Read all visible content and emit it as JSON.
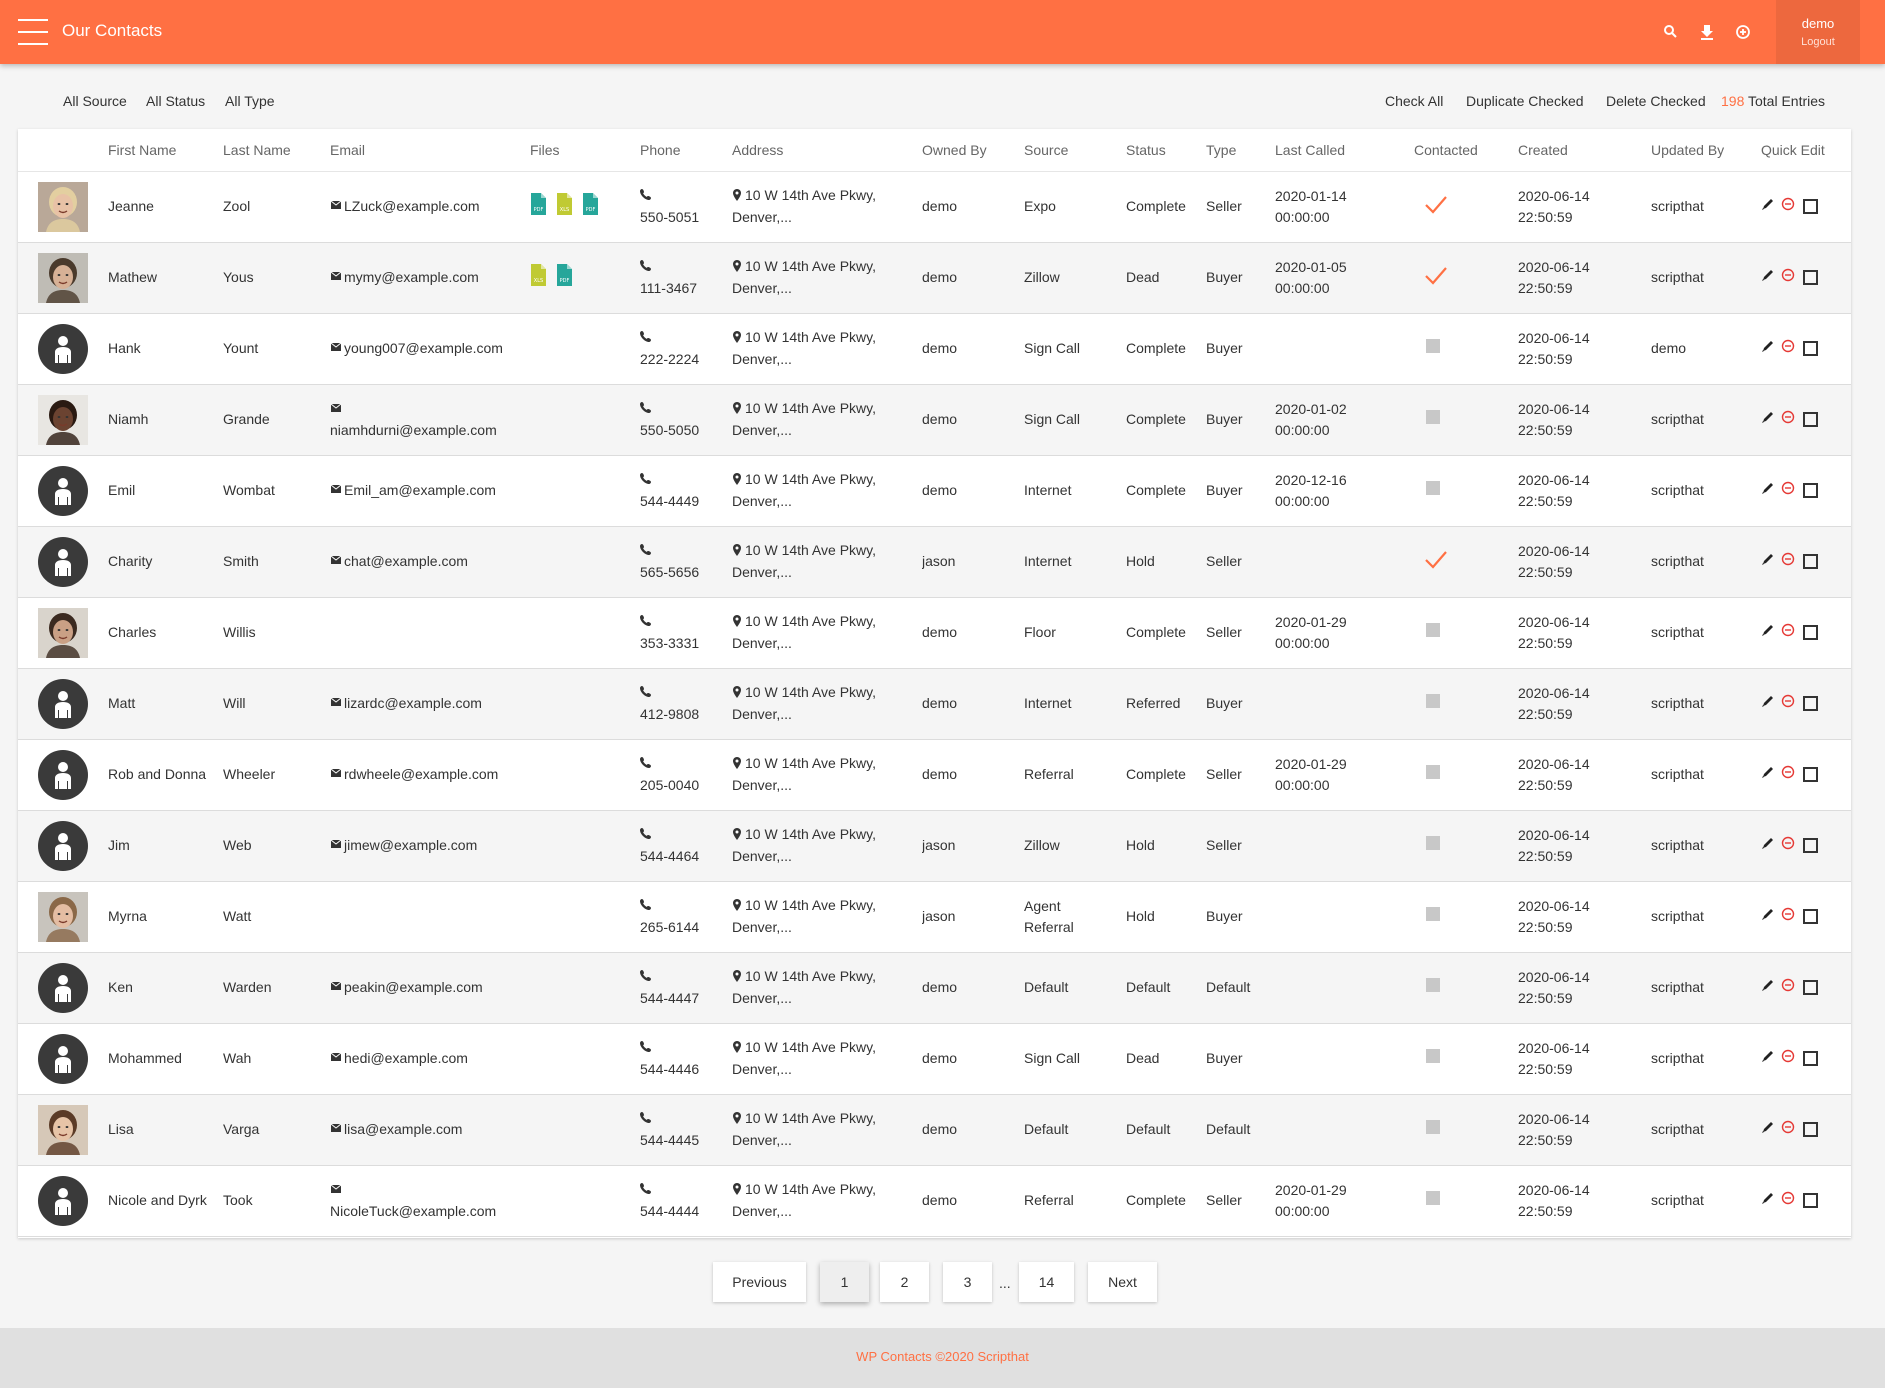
{
  "header": {
    "title": "Our Contacts",
    "user": "demo",
    "logout": "Logout",
    "accent_color": "#ff7043",
    "icons": [
      "search-icon",
      "download-icon",
      "add-icon"
    ]
  },
  "filters": {
    "source": "All Source",
    "status": "All Status",
    "type": "All Type"
  },
  "actions": {
    "check_all": "Check All",
    "duplicate_checked": "Duplicate Checked",
    "delete_checked": "Delete Checked",
    "total_count": "198",
    "total_label": "Total Entries"
  },
  "columns": [
    "First Name",
    "Last Name",
    "Email",
    "Files",
    "Phone",
    "Address",
    "Owned By",
    "Source",
    "Status",
    "Type",
    "Last Called",
    "Contacted",
    "Created",
    "Updated By",
    "Quick Edit"
  ],
  "rows": [
    {
      "first": "Jeanne",
      "last": "Zool",
      "email": "LZuck@example.com",
      "files": [
        "PDF",
        "XLS",
        "PDF"
      ],
      "phone": "550-5051",
      "address": "10 W 14th Ave Pkwy, Denver,...",
      "owner": "demo",
      "source": "Expo",
      "status": "Complete",
      "type": "Seller",
      "last_called": "2020-01-14 00:00:00",
      "contacted": true,
      "created": "2020-06-14 22:50:59",
      "updated_by": "scripthat",
      "avatar": "photo-woman-blond"
    },
    {
      "first": "Mathew",
      "last": "Yous",
      "email": "mymy@example.com",
      "files": [
        "XLS",
        "PDF"
      ],
      "phone": "111-3467",
      "address": "10 W 14th Ave Pkwy, Denver,...",
      "owner": "demo",
      "source": "Zillow",
      "status": "Dead",
      "type": "Buyer",
      "last_called": "2020-01-05 00:00:00",
      "contacted": true,
      "created": "2020-06-14 22:50:59",
      "updated_by": "scripthat",
      "avatar": "photo-man-bearded"
    },
    {
      "first": "Hank",
      "last": "Yount",
      "email": "young007@example.com",
      "files": [],
      "phone": "222-2224",
      "address": "10 W 14th Ave Pkwy, Denver,...",
      "owner": "demo",
      "source": "Sign Call",
      "status": "Complete",
      "type": "Buyer",
      "last_called": "",
      "contacted": false,
      "created": "2020-06-14 22:50:59",
      "updated_by": "demo",
      "avatar": "default"
    },
    {
      "first": "Niamh",
      "last": "Grande",
      "email": "niamhdurni@example.com",
      "files": [],
      "phone": "550-5050",
      "address": "10 W 14th Ave Pkwy, Denver,...",
      "owner": "demo",
      "source": "Sign Call",
      "status": "Complete",
      "type": "Buyer",
      "last_called": "2020-01-02 00:00:00",
      "contacted": false,
      "created": "2020-06-14 22:50:59",
      "updated_by": "scripthat",
      "avatar": "photo-woman-curly"
    },
    {
      "first": "Emil",
      "last": "Wombat",
      "email": "Emil_am@example.com",
      "files": [],
      "phone": "544-4449",
      "address": "10 W 14th Ave Pkwy, Denver,...",
      "owner": "demo",
      "source": "Internet",
      "status": "Complete",
      "type": "Buyer",
      "last_called": "2020-12-16 00:00:00",
      "contacted": false,
      "created": "2020-06-14 22:50:59",
      "updated_by": "scripthat",
      "avatar": "default"
    },
    {
      "first": "Charity",
      "last": "Smith",
      "email": "chat@example.com",
      "files": [],
      "phone": "565-5656",
      "address": "10 W 14th Ave Pkwy, Denver,...",
      "owner": "jason",
      "source": "Internet",
      "status": "Hold",
      "type": "Seller",
      "last_called": "",
      "contacted": true,
      "created": "2020-06-14 22:50:59",
      "updated_by": "scripthat",
      "avatar": "default"
    },
    {
      "first": "Charles",
      "last": "Willis",
      "email": "",
      "files": [],
      "phone": "353-3331",
      "address": "10 W 14th Ave Pkwy, Denver,...",
      "owner": "demo",
      "source": "Floor",
      "status": "Complete",
      "type": "Seller",
      "last_called": "2020-01-29 00:00:00",
      "contacted": false,
      "created": "2020-06-14 22:50:59",
      "updated_by": "scripthat",
      "avatar": "photo-man-shouting"
    },
    {
      "first": "Matt",
      "last": "Will",
      "email": "lizardc@example.com",
      "files": [],
      "phone": "412-9808",
      "address": "10 W 14th Ave Pkwy, Denver,...",
      "owner": "demo",
      "source": "Internet",
      "status": "Referred",
      "type": "Buyer",
      "last_called": "",
      "contacted": false,
      "created": "2020-06-14 22:50:59",
      "updated_by": "scripthat",
      "avatar": "default"
    },
    {
      "first": "Rob and Donna",
      "last": "Wheeler",
      "email": "rdwheele@example.com",
      "files": [],
      "phone": "205-0040",
      "address": "10 W 14th Ave Pkwy, Denver,...",
      "owner": "demo",
      "source": "Referral",
      "status": "Complete",
      "type": "Seller",
      "last_called": "2020-01-29 00:00:00",
      "contacted": false,
      "created": "2020-06-14 22:50:59",
      "updated_by": "scripthat",
      "avatar": "default"
    },
    {
      "first": "Jim",
      "last": "Web",
      "email": "jimew@example.com",
      "files": [],
      "phone": "544-4464",
      "address": "10 W 14th Ave Pkwy, Denver,...",
      "owner": "jason",
      "source": "Zillow",
      "status": "Hold",
      "type": "Seller",
      "last_called": "",
      "contacted": false,
      "created": "2020-06-14 22:50:59",
      "updated_by": "scripthat",
      "avatar": "default"
    },
    {
      "first": "Myrna",
      "last": "Watt",
      "email": "",
      "files": [],
      "phone": "265-6144",
      "address": "10 W 14th Ave Pkwy, Denver,...",
      "owner": "jason",
      "source": "Agent Referral",
      "status": "Hold",
      "type": "Buyer",
      "last_called": "",
      "contacted": false,
      "created": "2020-06-14 22:50:59",
      "updated_by": "scripthat",
      "avatar": "photo-woman-thinking"
    },
    {
      "first": "Ken",
      "last": "Warden",
      "email": "peakin@example.com",
      "files": [],
      "phone": "544-4447",
      "address": "10 W 14th Ave Pkwy, Denver,...",
      "owner": "demo",
      "source": "Default",
      "status": "Default",
      "type": "Default",
      "last_called": "",
      "contacted": false,
      "created": "2020-06-14 22:50:59",
      "updated_by": "scripthat",
      "avatar": "default"
    },
    {
      "first": "Mohammed",
      "last": "Wah",
      "email": "hedi@example.com",
      "files": [],
      "phone": "544-4446",
      "address": "10 W 14th Ave Pkwy, Denver,...",
      "owner": "demo",
      "source": "Sign Call",
      "status": "Dead",
      "type": "Buyer",
      "last_called": "",
      "contacted": false,
      "created": "2020-06-14 22:50:59",
      "updated_by": "scripthat",
      "avatar": "default"
    },
    {
      "first": "Lisa",
      "last": "Varga",
      "email": "lisa@example.com",
      "files": [],
      "phone": "544-4445",
      "address": "10 W 14th Ave Pkwy, Denver,...",
      "owner": "demo",
      "source": "Default",
      "status": "Default",
      "type": "Default",
      "last_called": "",
      "contacted": false,
      "created": "2020-06-14 22:50:59",
      "updated_by": "scripthat",
      "avatar": "photo-woman-laughing"
    },
    {
      "first": "Nicole and Dyrk",
      "last": "Took",
      "email": "NicoleTuck@example.com",
      "files": [],
      "phone": "544-4444",
      "address": "10 W 14th Ave Pkwy, Denver,...",
      "owner": "demo",
      "source": "Referral",
      "status": "Complete",
      "type": "Seller",
      "last_called": "2020-01-29 00:00:00",
      "contacted": false,
      "created": "2020-06-14 22:50:59",
      "updated_by": "scripthat",
      "avatar": "default"
    }
  ],
  "pagination": {
    "previous": "Previous",
    "pages": [
      "1",
      "2",
      "3"
    ],
    "ellipsis": "...",
    "last": "14",
    "next": "Next",
    "current": "1"
  },
  "footer": {
    "text": "WP Contacts ©2020 Scripthat"
  },
  "colors": {
    "accent": "#ff7043",
    "file_pdf": "#26a69a",
    "file_xls": "#c0ca33",
    "delete": "#e53935"
  }
}
